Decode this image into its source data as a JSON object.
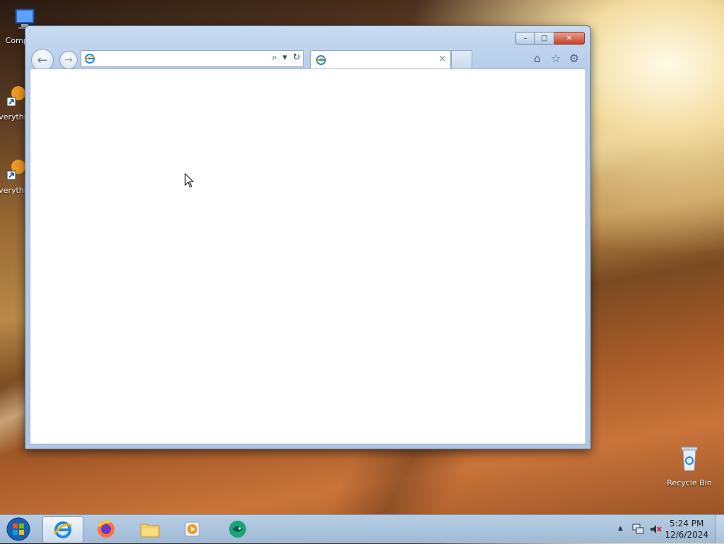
{
  "desktop": {
    "icons": [
      {
        "label": "Computer",
        "icon": "computer-icon"
      },
      {
        "label": "Everything",
        "icon": "everything-shortcut-icon"
      },
      {
        "label": "Everything",
        "icon": "everything-shortcut-icon"
      },
      {
        "label": "Recycle Bin",
        "icon": "recycle-bin-icon"
      }
    ]
  },
  "browser": {
    "address": {
      "value": "",
      "placeholder": ""
    },
    "tab": {
      "title": ""
    },
    "controls": {
      "minimize": "–",
      "maximize": "□",
      "close": "✕"
    },
    "toolbar": {
      "back": "←",
      "forward": "→",
      "search": "⌕",
      "dropdown": "▾",
      "refresh": "↻",
      "close_tab": "×"
    },
    "right_tools": {
      "home": "⌂",
      "favorites": "☆",
      "settings": "⚙"
    }
  },
  "taskbar": {
    "pinned": [
      "internet-explorer",
      "firefox",
      "file-explorer",
      "media-player",
      "app"
    ],
    "active": "internet-explorer",
    "clock": {
      "time": "5:24 PM",
      "date": "12/6/2024"
    }
  }
}
